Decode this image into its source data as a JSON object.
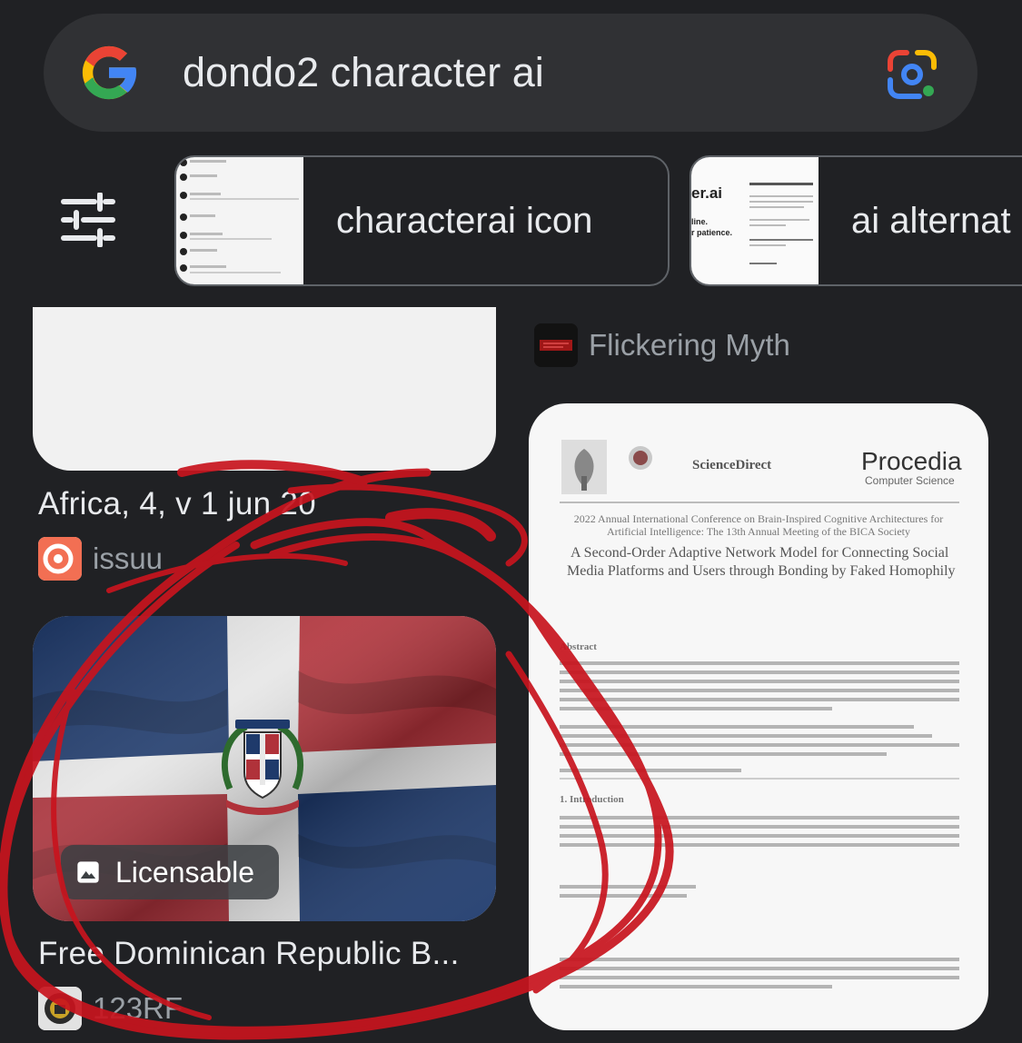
{
  "search": {
    "query": "dondo2 character ai"
  },
  "chips": [
    {
      "label": "characterai icon",
      "thumb_text": []
    },
    {
      "label": "ai alternat",
      "thumb_text": [
        "er.ai",
        "line.",
        "r patience."
      ]
    }
  ],
  "results": {
    "left": [
      {
        "title": "Africa",
        "title_tail": ", 4, v 1 jun 20",
        "source": "issuu"
      },
      {
        "title": "Free Dominican Republic B...",
        "source": "123RF",
        "badge": "Licensable"
      }
    ],
    "right": [
      {
        "source": "Flickering Myth"
      },
      {
        "paper": {
          "logo_center": "ScienceDirect",
          "journal": "Procedia",
          "journal_sub": "Computer Science",
          "heading": "2022 Annual International Conference on Brain-Inspired Cognitive Architectures for Artificial Intelligence: The 13th Annual Meeting of the BICA Society",
          "title_line1": "A Second-Order Adaptive Network Model for Connecting Social",
          "title_line2": "Media Platforms and Users through Bonding by Faked Homophily",
          "abstract": "Abstract",
          "intro": "1. Introduction"
        }
      }
    ]
  },
  "colors": {
    "background": "#202124",
    "search_bar": "#303134",
    "red_annotation": "#c8141e",
    "google_blue": "#4285F4",
    "google_red": "#EA4335",
    "google_yellow": "#FBBC05",
    "google_green": "#34A853"
  }
}
